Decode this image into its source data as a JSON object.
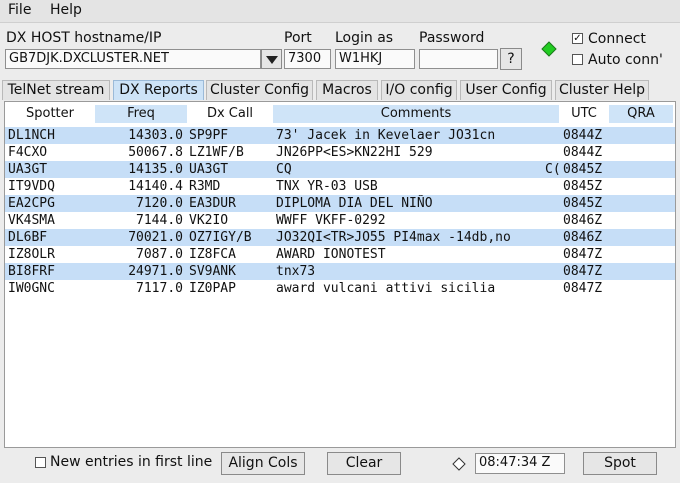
{
  "menu": {
    "file": "File",
    "help": "Help"
  },
  "host": {
    "label": "DX HOST hostname/IP",
    "value": "GB7DJK.DXCLUSTER.NET",
    "port_label": "Port",
    "port_value": "7300",
    "login_label": "Login as",
    "login_value": "W1HKJ",
    "password_label": "Password",
    "password_value": "",
    "help_button": "?",
    "connect_label": "Connect",
    "connect_checked": true,
    "autoconn_label": "Auto conn'",
    "autoconn_checked": false,
    "status_color": "#22cc22"
  },
  "tabs": [
    {
      "label": "TelNet stream"
    },
    {
      "label": "DX Reports"
    },
    {
      "label": "Cluster Config"
    },
    {
      "label": "Macros"
    },
    {
      "label": "I/O config"
    },
    {
      "label": "User Config"
    },
    {
      "label": "Cluster Help"
    }
  ],
  "table": {
    "headers": [
      "Spotter",
      "Freq",
      "Dx Call",
      "Comments",
      "UTC",
      "QRA"
    ],
    "rows": [
      {
        "spotter": "DL1NCH",
        "freq": "14303.0",
        "call": "SP9PF",
        "comment": "73' Jacek in Kevelaer JO31cn",
        "extra": "",
        "utc": "0844Z"
      },
      {
        "spotter": "F4CXO",
        "freq": "50067.8",
        "call": "LZ1WF/B",
        "comment": "JN26PP<ES>KN22HI 529",
        "extra": "",
        "utc": "0844Z"
      },
      {
        "spotter": "UA3GT",
        "freq": "14135.0",
        "call": "UA3GT",
        "comment": "CQ",
        "extra": "C(",
        "utc": "0845Z"
      },
      {
        "spotter": "IT9VDQ",
        "freq": "14140.4",
        "call": "R3MD",
        "comment": "TNX YR-03 USB",
        "extra": "",
        "utc": "0845Z"
      },
      {
        "spotter": "EA2CPG",
        "freq": "7120.0",
        "call": "EA3DUR",
        "comment": "DIPLOMA DIA DEL NIÑO",
        "extra": "",
        "utc": "0845Z"
      },
      {
        "spotter": "VK4SMA",
        "freq": "7144.0",
        "call": "VK2IO",
        "comment": "WWFF VKFF-0292",
        "extra": "",
        "utc": "0846Z"
      },
      {
        "spotter": "DL6BF",
        "freq": "70021.0",
        "call": "OZ7IGY/B",
        "comment": "JO32QI<TR>JO55 PI4max -14db,no",
        "extra": "",
        "utc": "0846Z"
      },
      {
        "spotter": "IZ8OLR",
        "freq": "7087.0",
        "call": "IZ8FCA",
        "comment": "AWARD IONOTEST",
        "extra": "",
        "utc": "0847Z"
      },
      {
        "spotter": "BI8FRF",
        "freq": "24971.0",
        "call": "SV9ANK",
        "comment": "tnx73",
        "extra": "",
        "utc": "0847Z"
      },
      {
        "spotter": "IW0GNC",
        "freq": "7117.0",
        "call": "IZ0PAP",
        "comment": "award vulcani attivi sicilia",
        "extra": "",
        "utc": "0847Z"
      }
    ]
  },
  "footer": {
    "new_entries_label": "New entries in first line",
    "new_entries_checked": false,
    "align_button": "Align Cols",
    "clear_button": "Clear",
    "time_value": "08:47:34 Z",
    "spot_button": "Spot",
    "indicator_color": "#ffffff"
  }
}
